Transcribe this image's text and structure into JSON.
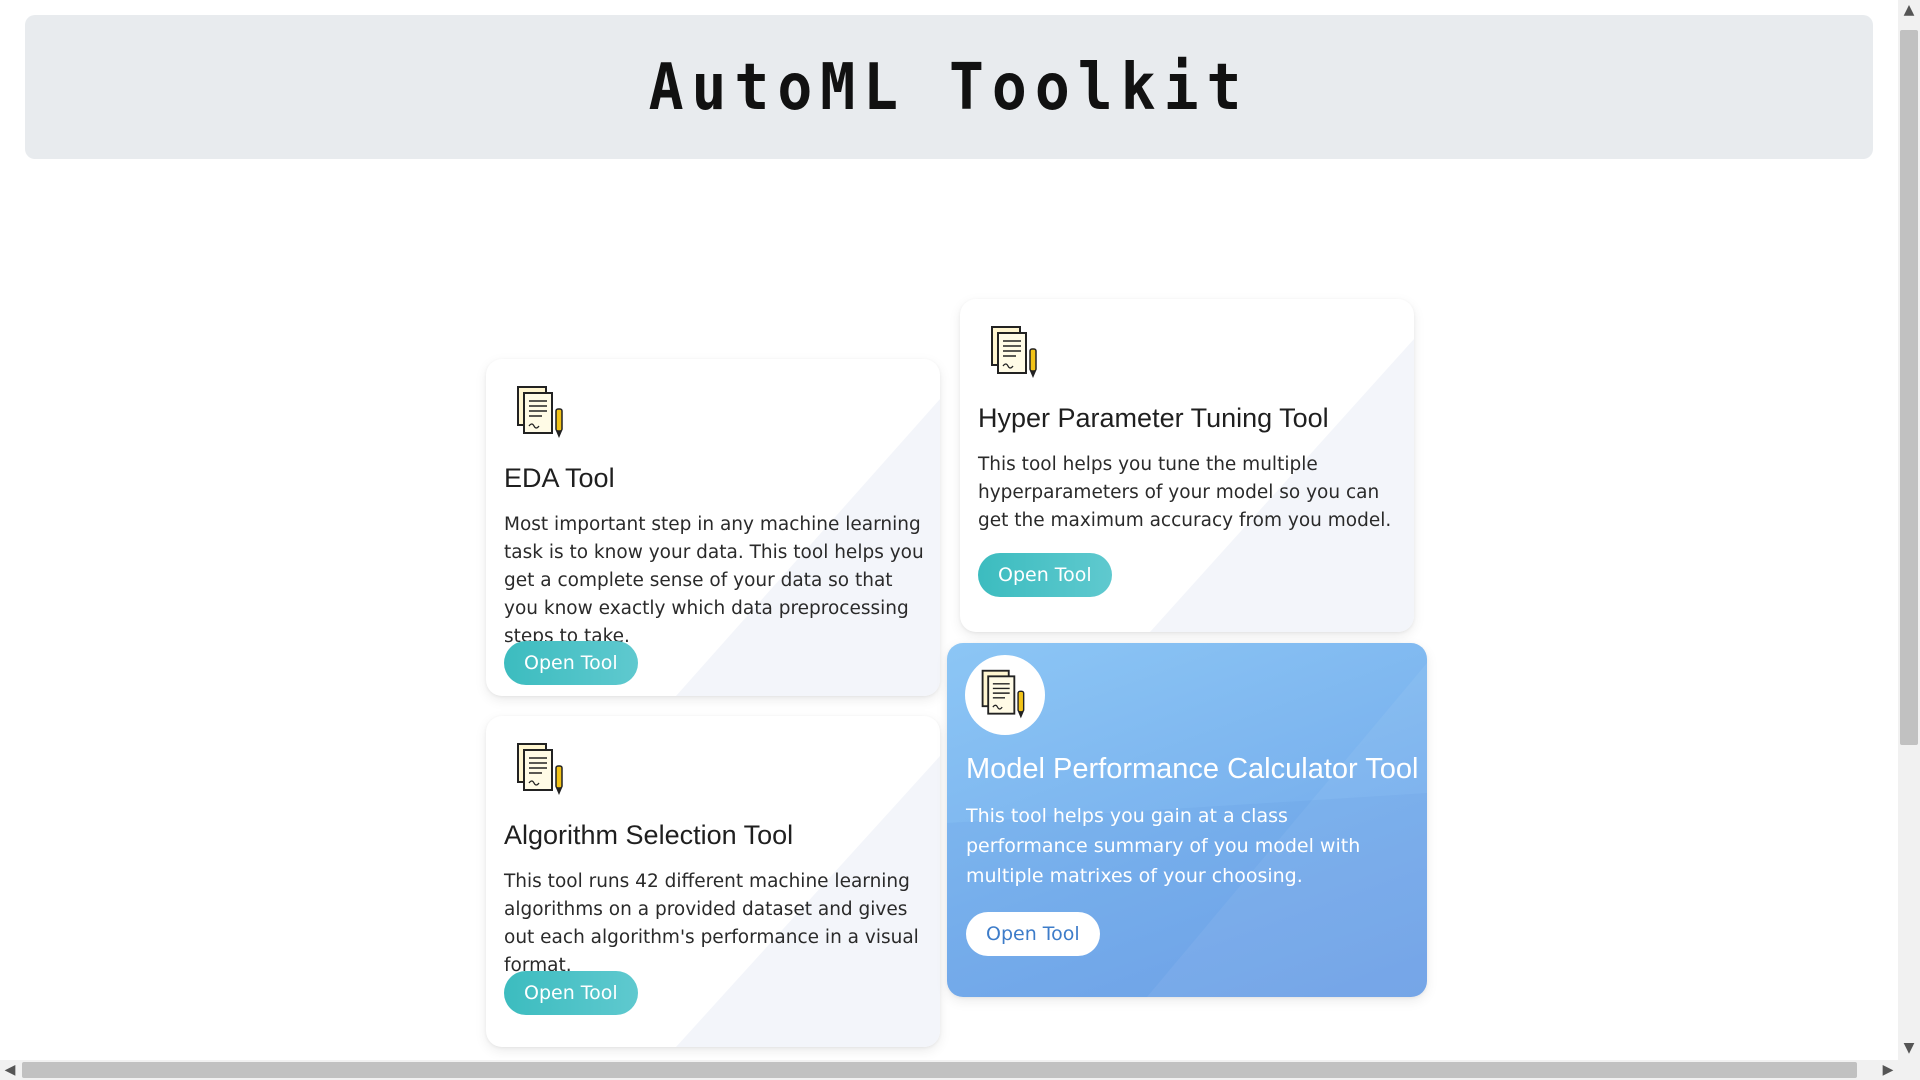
{
  "header": {
    "title": "AutoML Toolkit"
  },
  "cards": [
    {
      "title": "EDA Tool",
      "description": "Most important step in any machine learning task is to know your data. This tool helps you get a complete sense of your data so that you know exactly which data preprocessing steps to take.",
      "button": "Open Tool",
      "icon": "document-pen-icon"
    },
    {
      "title": "Hyper Parameter Tuning Tool",
      "description": "This tool helps you tune the multiple hyperparameters of your model so you can get the maximum accuracy from you model.",
      "button": "Open Tool",
      "icon": "document-pen-icon"
    },
    {
      "title": "Algorithm Selection Tool",
      "description": "This tool runs 42 different machine learning algorithms on a provided dataset and gives out each algorithm's performance in a visual format.",
      "button": "Open Tool",
      "icon": "document-pen-icon"
    },
    {
      "title": "Model Performance Calculator Tool",
      "description": "This tool helps you gain at a class performance summary of you model with multiple matrixes of your choosing.",
      "button": "Open Tool",
      "icon": "document-pen-icon"
    }
  ],
  "colors": {
    "accent_teal": "#3cbcbf",
    "active_card_blue": "#7ab2ee",
    "header_bg": "#e8ebee"
  }
}
